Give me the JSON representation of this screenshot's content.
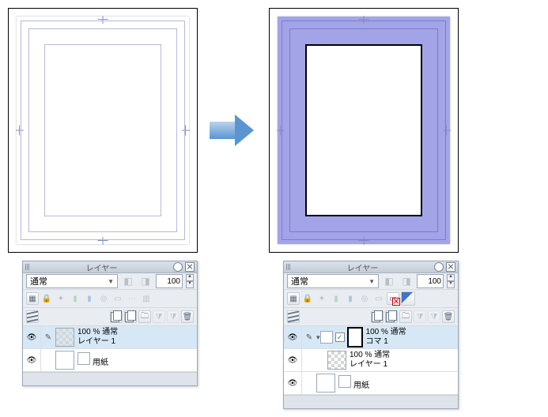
{
  "arrow": "→",
  "panelLeft": {
    "title": "レイヤー",
    "blendMode": "通常",
    "opacity": "100",
    "layers": [
      {
        "opacity": "100 % 通常",
        "name": "レイヤー 1"
      },
      {
        "opacity": "",
        "name": "用紙"
      }
    ]
  },
  "panelRight": {
    "title": "レイヤー",
    "blendMode": "通常",
    "opacity": "100",
    "layers": [
      {
        "opacity": "100 % 通常",
        "name": "コマ 1"
      },
      {
        "opacity": "100 % 通常",
        "name": "レイヤー 1"
      },
      {
        "opacity": "",
        "name": "用紙"
      }
    ]
  }
}
